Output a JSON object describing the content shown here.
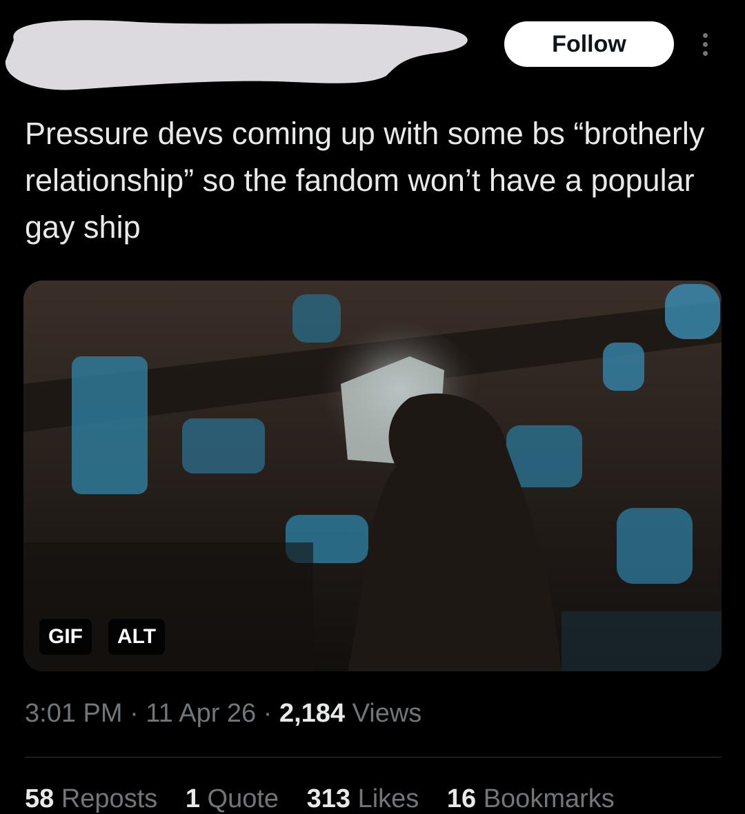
{
  "header": {
    "follow_label": "Follow",
    "more_icon": "more-vertical-icon"
  },
  "tweet": {
    "text": "Pressure devs coming up with some bs “brotherly relationship” so the fandom won’t have a popular gay ship",
    "media": {
      "gif_badge": "GIF",
      "alt_badge": "ALT"
    },
    "meta": {
      "time": "3:01 PM",
      "separator": "·",
      "date": "11 Apr 26",
      "views_count": "2,184",
      "views_label": "Views"
    },
    "stats": [
      {
        "count": "58",
        "label": "Reposts"
      },
      {
        "count": "1",
        "label": "Quote"
      },
      {
        "count": "313",
        "label": "Likes"
      },
      {
        "count": "16",
        "label": "Bookmarks"
      }
    ]
  },
  "colors": {
    "background": "#000000",
    "text_primary": "#e7e9ea",
    "text_secondary": "#71767b",
    "divider": "#2f3336",
    "follow_bg": "#ffffff",
    "redaction": "#dcdadf"
  }
}
